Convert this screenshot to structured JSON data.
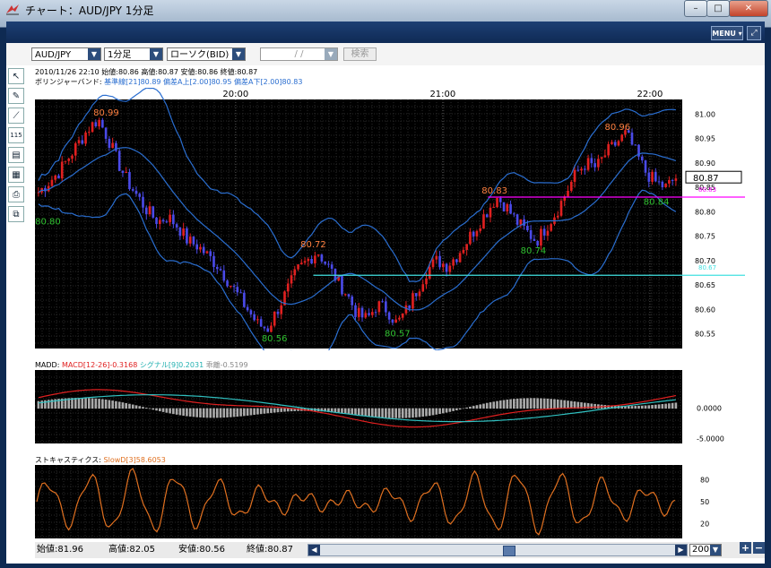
{
  "window": {
    "title": "チャート：AUD/JPY 1分足",
    "minimize": "–",
    "maximize": "□",
    "close": "✕"
  },
  "header": {
    "menu_label": "MENU ▾",
    "expand_label": "⤢"
  },
  "toolbar": {
    "pair": "AUD/JPY",
    "interval": "1分足",
    "chart_type": "ローソク(BID)",
    "date_placeholder": "/ /",
    "search_label": "検索"
  },
  "tools": [
    "cursor-tool-icon",
    "pencil-tool-icon",
    "line-tool-icon",
    "ruler-tool-icon",
    "list-tool-icon",
    "table-tool-icon",
    "print-tool-icon",
    "copy-tool-icon"
  ],
  "tool_glyphs": [
    "↖",
    "✎",
    "⟋",
    "115",
    "▤",
    "▦",
    "⎙",
    "⧉"
  ],
  "price_panel": {
    "ohlc_line": "2010/11/26 22:10  始値:80.86  高値:80.87  安値:80.86  終値:80.87",
    "bb_label": "ボリンジャーバンド:",
    "bb_mid": "基準線[21]80.89",
    "bb_up": "偏差A上[2.00]80.95",
    "bb_dn": "偏差A下[2.00]80.83",
    "time_labels": [
      "20:00",
      "21:00",
      "22:00"
    ],
    "y_ticks": [
      "81.00",
      "80.95",
      "80.90",
      "80.85",
      "80.80",
      "80.75",
      "80.70",
      "80.65",
      "80.60",
      "80.55"
    ],
    "current_price": "80.87",
    "magenta_line_value": "80.83",
    "cyan_line_value": "80.67",
    "annotations": {
      "a1": "80.99",
      "a2": "80.80",
      "a3": "80.72",
      "a4": "80.56",
      "a5": "80.57",
      "a6": "80.83",
      "a7": "80.74",
      "a8": "80.96",
      "a9": "80.84"
    },
    "colors": {
      "up": "#e02020",
      "down": "#4a4ae8",
      "band": "#2a6ed0",
      "magenta": "#ff00ff",
      "cyan": "#40e0e0",
      "high_label": "#ff8040",
      "low_label": "#30c030"
    }
  },
  "macd_panel": {
    "label": "MADD:",
    "macd": "MACD[12-26]-0.3168",
    "signal": "シグナル[9]0.2031",
    "divergence": "乖離-0.5199",
    "y_ticks": [
      "0.0000",
      "-5.0000"
    ]
  },
  "stoch_panel": {
    "label": "ストキャスティクス:",
    "slowd": "SlowD[3]58.6053",
    "y_ticks": [
      "80",
      "50",
      "20"
    ]
  },
  "footer": {
    "open": "始値:81.96",
    "high": "高値:82.05",
    "low": "安値:80.56",
    "close": "終値:80.87",
    "scroll_position": 0.53,
    "zoom": "200"
  },
  "chart_data": {
    "type": "candlestick",
    "title": "AUD/JPY 1分足",
    "ylim": [
      80.52,
      81.03
    ],
    "x_ticks": [
      "20:00",
      "21:00",
      "22:00"
    ],
    "close_path": [
      80.84,
      80.86,
      80.88,
      80.91,
      80.94,
      80.97,
      80.99,
      80.95,
      80.9,
      80.86,
      80.83,
      80.8,
      80.78,
      80.79,
      80.77,
      80.74,
      80.73,
      80.71,
      80.69,
      80.66,
      80.63,
      80.6,
      80.57,
      80.56,
      80.6,
      80.64,
      80.68,
      80.7,
      80.72,
      80.69,
      80.66,
      80.63,
      80.59,
      80.58,
      80.61,
      80.6,
      80.57,
      80.6,
      80.64,
      80.68,
      80.7,
      80.69,
      80.71,
      80.74,
      80.77,
      80.8,
      80.83,
      80.81,
      80.78,
      80.76,
      80.74,
      80.77,
      80.8,
      80.84,
      80.88,
      80.9,
      80.89,
      80.92,
      80.94,
      80.96,
      80.92,
      80.88,
      80.86,
      80.85,
      80.87
    ]
  }
}
